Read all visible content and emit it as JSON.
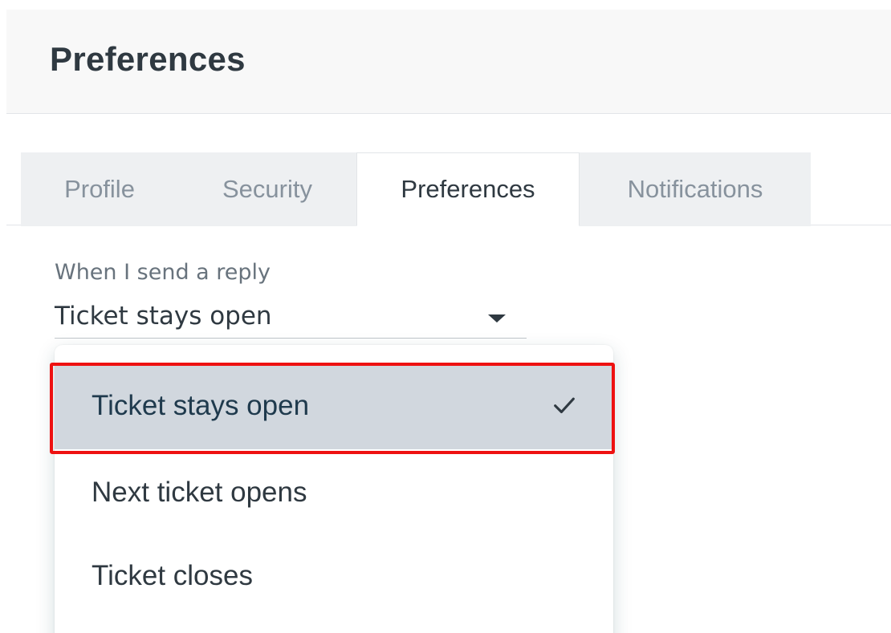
{
  "header": {
    "title": "Preferences"
  },
  "tabs": [
    {
      "label": "Profile",
      "active": false
    },
    {
      "label": "Security",
      "active": false
    },
    {
      "label": "Preferences",
      "active": true
    },
    {
      "label": "Notifications",
      "active": false
    }
  ],
  "reply_setting": {
    "label": "When I send a reply",
    "selected_value": "Ticket stays open",
    "options": [
      {
        "label": "Ticket stays open",
        "selected": true
      },
      {
        "label": "Next ticket opens",
        "selected": false
      },
      {
        "label": "Ticket closes",
        "selected": false
      }
    ]
  },
  "icons": {
    "caret": "caret-down-icon",
    "check": "check-icon"
  },
  "colors": {
    "text_dark": "#2f3941",
    "text_muted": "#87929d",
    "selected_bg": "#d1d7de",
    "highlight": "#ee1111"
  }
}
